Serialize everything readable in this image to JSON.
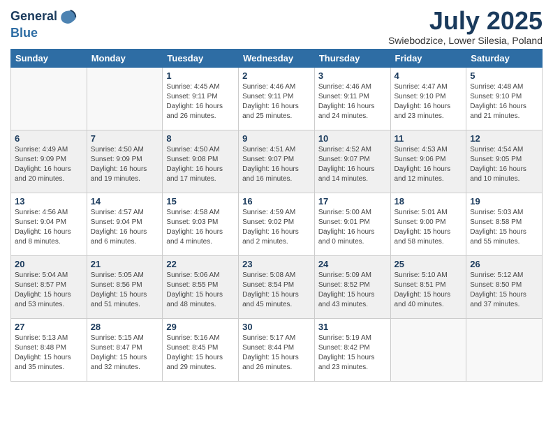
{
  "header": {
    "logo_line1": "General",
    "logo_line2": "Blue",
    "month": "July 2025",
    "location": "Swiebodzice, Lower Silesia, Poland"
  },
  "weekdays": [
    "Sunday",
    "Monday",
    "Tuesday",
    "Wednesday",
    "Thursday",
    "Friday",
    "Saturday"
  ],
  "weeks": [
    [
      {
        "day": "",
        "info": ""
      },
      {
        "day": "",
        "info": ""
      },
      {
        "day": "1",
        "info": "Sunrise: 4:45 AM\nSunset: 9:11 PM\nDaylight: 16 hours\nand 26 minutes."
      },
      {
        "day": "2",
        "info": "Sunrise: 4:46 AM\nSunset: 9:11 PM\nDaylight: 16 hours\nand 25 minutes."
      },
      {
        "day": "3",
        "info": "Sunrise: 4:46 AM\nSunset: 9:11 PM\nDaylight: 16 hours\nand 24 minutes."
      },
      {
        "day": "4",
        "info": "Sunrise: 4:47 AM\nSunset: 9:10 PM\nDaylight: 16 hours\nand 23 minutes."
      },
      {
        "day": "5",
        "info": "Sunrise: 4:48 AM\nSunset: 9:10 PM\nDaylight: 16 hours\nand 21 minutes."
      }
    ],
    [
      {
        "day": "6",
        "info": "Sunrise: 4:49 AM\nSunset: 9:09 PM\nDaylight: 16 hours\nand 20 minutes."
      },
      {
        "day": "7",
        "info": "Sunrise: 4:50 AM\nSunset: 9:09 PM\nDaylight: 16 hours\nand 19 minutes."
      },
      {
        "day": "8",
        "info": "Sunrise: 4:50 AM\nSunset: 9:08 PM\nDaylight: 16 hours\nand 17 minutes."
      },
      {
        "day": "9",
        "info": "Sunrise: 4:51 AM\nSunset: 9:07 PM\nDaylight: 16 hours\nand 16 minutes."
      },
      {
        "day": "10",
        "info": "Sunrise: 4:52 AM\nSunset: 9:07 PM\nDaylight: 16 hours\nand 14 minutes."
      },
      {
        "day": "11",
        "info": "Sunrise: 4:53 AM\nSunset: 9:06 PM\nDaylight: 16 hours\nand 12 minutes."
      },
      {
        "day": "12",
        "info": "Sunrise: 4:54 AM\nSunset: 9:05 PM\nDaylight: 16 hours\nand 10 minutes."
      }
    ],
    [
      {
        "day": "13",
        "info": "Sunrise: 4:56 AM\nSunset: 9:04 PM\nDaylight: 16 hours\nand 8 minutes."
      },
      {
        "day": "14",
        "info": "Sunrise: 4:57 AM\nSunset: 9:04 PM\nDaylight: 16 hours\nand 6 minutes."
      },
      {
        "day": "15",
        "info": "Sunrise: 4:58 AM\nSunset: 9:03 PM\nDaylight: 16 hours\nand 4 minutes."
      },
      {
        "day": "16",
        "info": "Sunrise: 4:59 AM\nSunset: 9:02 PM\nDaylight: 16 hours\nand 2 minutes."
      },
      {
        "day": "17",
        "info": "Sunrise: 5:00 AM\nSunset: 9:01 PM\nDaylight: 16 hours\nand 0 minutes."
      },
      {
        "day": "18",
        "info": "Sunrise: 5:01 AM\nSunset: 9:00 PM\nDaylight: 15 hours\nand 58 minutes."
      },
      {
        "day": "19",
        "info": "Sunrise: 5:03 AM\nSunset: 8:58 PM\nDaylight: 15 hours\nand 55 minutes."
      }
    ],
    [
      {
        "day": "20",
        "info": "Sunrise: 5:04 AM\nSunset: 8:57 PM\nDaylight: 15 hours\nand 53 minutes."
      },
      {
        "day": "21",
        "info": "Sunrise: 5:05 AM\nSunset: 8:56 PM\nDaylight: 15 hours\nand 51 minutes."
      },
      {
        "day": "22",
        "info": "Sunrise: 5:06 AM\nSunset: 8:55 PM\nDaylight: 15 hours\nand 48 minutes."
      },
      {
        "day": "23",
        "info": "Sunrise: 5:08 AM\nSunset: 8:54 PM\nDaylight: 15 hours\nand 45 minutes."
      },
      {
        "day": "24",
        "info": "Sunrise: 5:09 AM\nSunset: 8:52 PM\nDaylight: 15 hours\nand 43 minutes."
      },
      {
        "day": "25",
        "info": "Sunrise: 5:10 AM\nSunset: 8:51 PM\nDaylight: 15 hours\nand 40 minutes."
      },
      {
        "day": "26",
        "info": "Sunrise: 5:12 AM\nSunset: 8:50 PM\nDaylight: 15 hours\nand 37 minutes."
      }
    ],
    [
      {
        "day": "27",
        "info": "Sunrise: 5:13 AM\nSunset: 8:48 PM\nDaylight: 15 hours\nand 35 minutes."
      },
      {
        "day": "28",
        "info": "Sunrise: 5:15 AM\nSunset: 8:47 PM\nDaylight: 15 hours\nand 32 minutes."
      },
      {
        "day": "29",
        "info": "Sunrise: 5:16 AM\nSunset: 8:45 PM\nDaylight: 15 hours\nand 29 minutes."
      },
      {
        "day": "30",
        "info": "Sunrise: 5:17 AM\nSunset: 8:44 PM\nDaylight: 15 hours\nand 26 minutes."
      },
      {
        "day": "31",
        "info": "Sunrise: 5:19 AM\nSunset: 8:42 PM\nDaylight: 15 hours\nand 23 minutes."
      },
      {
        "day": "",
        "info": ""
      },
      {
        "day": "",
        "info": ""
      }
    ]
  ]
}
